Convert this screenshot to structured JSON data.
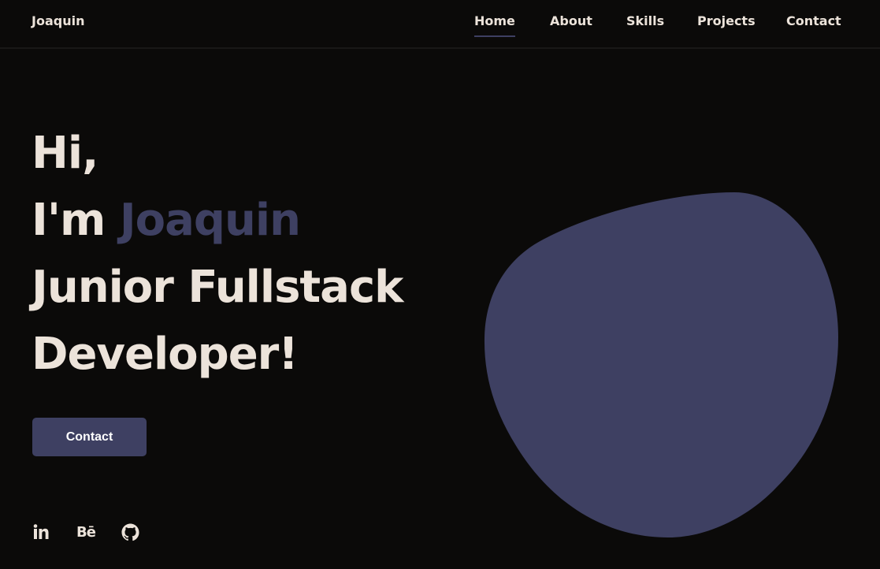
{
  "header": {
    "logo": "Joaquin",
    "nav": [
      {
        "label": "Home",
        "active": true
      },
      {
        "label": "About",
        "active": false
      },
      {
        "label": "Skills",
        "active": false
      },
      {
        "label": "Projects",
        "active": false
      },
      {
        "label": "Contact",
        "active": false
      }
    ]
  },
  "hero": {
    "line1": "Hi,",
    "line2_prefix": "I'm ",
    "name": "Joaquin",
    "line3": "Junior Fullstack",
    "line4": "Developer!",
    "button_label": "Contact"
  },
  "social": {
    "icons": [
      "linkedin-icon",
      "behance-icon",
      "github-icon"
    ],
    "behance_text": "Bē"
  },
  "colors": {
    "background": "#0b0a09",
    "text": "#ece3da",
    "accent": "#3e4062"
  }
}
